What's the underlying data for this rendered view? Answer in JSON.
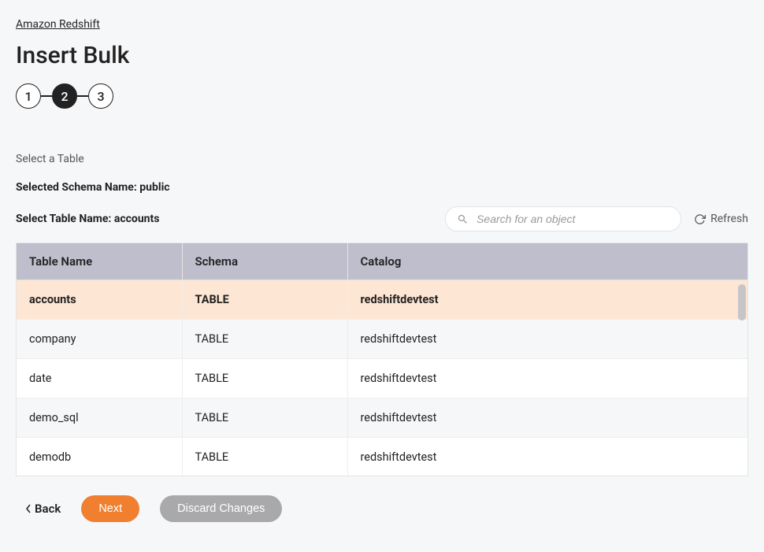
{
  "breadcrumb": "Amazon Redshift",
  "title": "Insert Bulk",
  "stepper": {
    "steps": [
      "1",
      "2",
      "3"
    ],
    "active_index": 1
  },
  "labels": {
    "select_table": "Select a Table",
    "selected_schema_prefix": "Selected Schema Name: ",
    "selected_schema_value": "public",
    "select_table_prefix": "Select Table Name: ",
    "select_table_value": "accounts"
  },
  "search": {
    "placeholder": "Search for an object"
  },
  "refresh_label": "Refresh",
  "table": {
    "headers": {
      "name": "Table Name",
      "schema": "Schema",
      "catalog": "Catalog"
    },
    "rows": [
      {
        "name": "accounts",
        "schema": "TABLE",
        "catalog": "redshiftdevtest",
        "selected": true
      },
      {
        "name": "company",
        "schema": "TABLE",
        "catalog": "redshiftdevtest",
        "selected": false
      },
      {
        "name": "date",
        "schema": "TABLE",
        "catalog": "redshiftdevtest",
        "selected": false
      },
      {
        "name": "demo_sql",
        "schema": "TABLE",
        "catalog": "redshiftdevtest",
        "selected": false
      },
      {
        "name": "demodb",
        "schema": "TABLE",
        "catalog": "redshiftdevtest",
        "selected": false
      }
    ]
  },
  "footer": {
    "back": "Back",
    "next": "Next",
    "discard": "Discard Changes"
  }
}
